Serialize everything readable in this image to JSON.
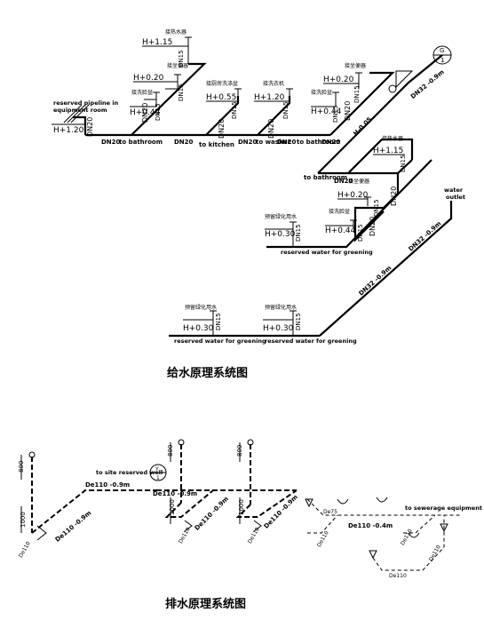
{
  "supply": {
    "title": "给水原理系统图",
    "labels": {
      "reserved_pipeline": "reserved pipeline in",
      "equipment_room": "equipment room",
      "h_plus_1_20_a": "H+1.20",
      "dn20_1": "DN20",
      "to_bathroom_1": "to bathroom",
      "dn20_2": "DN20",
      "to_kitchen": "to kitchen",
      "dn20_3": "DN20",
      "to_washer": "to washer",
      "dn20_4": "DN20",
      "to_bathroom_2": "to bathroom",
      "dn20_5": "DN20",
      "h_plus_1_15_a": "H+1.15",
      "cn_water_heater": "接热水器",
      "dn15_a": "DN15",
      "h_plus_0_20_a": "H+0.20",
      "cn_toilet_a": "接坐便器",
      "dn15_b": "DN15",
      "cn_basin_a": "接洗脸盆",
      "h_plus_0_44_a": "H+0.44",
      "dn15_c": "DN15",
      "dn20_6": "DN20",
      "cn_kitchen_sink": "接厨房洗涤盆",
      "h_plus_0_55": "H+0.55",
      "dn15_d": "DN15",
      "dn20_7": "DN20",
      "cn_washer": "接洗衣机",
      "h_plus_1_20_b": "H+1.20",
      "dn15_e": "DN15",
      "dn20_8": "DN20",
      "h_plus_0_20_b": "H+0.20",
      "cn_toilet_b": "接坐便器",
      "dn15_f": "DN15",
      "cn_basin_b": "接洗脸盆",
      "h_plus_0_44_b": "H+0.44",
      "dn15_g": "DN15",
      "dn20_9": "DN20",
      "h_minus_0_05": "H-0.05",
      "dn32_0_9m_a": "DN32 -0.9m",
      "meter_top": "G",
      "meter_bottom": "1",
      "cn_water_heater_b": "接热水器",
      "h_plus_1_15_b": "H+1.15",
      "dn15_h": "DN15",
      "to_bathroom_3": "to bathroom",
      "dn20_10": "DN20",
      "cn_toilet_c": "接坐便器",
      "h_plus_0_20_c": "H+0.20",
      "dn15_i": "DN15",
      "dn20_11": "DN20",
      "cn_basin_c": "接洗脸盆",
      "h_plus_0_44_c": "H+0.44",
      "dn15_j": "DN15",
      "dn20_12": "DN20",
      "cn_greening_a": "预留绿化用水",
      "h_plus_0_30_a": "H+0.30",
      "dn15_k": "DN15",
      "reserved_greening_a": "reserved water for greening",
      "water": "water",
      "outlet": "outlet",
      "dn32_0_9m_b": "DN32 -0.9m",
      "dn32_0_9m_c": "DN32 -0.9m",
      "cn_greening_b": "预留绿化用水",
      "h_plus_0_30_b": "H+0.30",
      "dn15_l": "DN15",
      "reserved_greening_b": "reserved water for greening",
      "cn_greening_c": "预留绿化用水",
      "h_plus_0_30_c": "H+0.30",
      "dn15_m": "DN15",
      "reserved_greening_c": "reserved water for greening"
    }
  },
  "drainage": {
    "title": "排水原理系统图",
    "labels": {
      "h800_a": "800",
      "h1000_a": "1000",
      "de110_a": "De110",
      "de110_0_9m_a": "De110 -0.9m",
      "de110_0_9m_b": "De110 -0.9m",
      "to_site_well": "to site reserved well",
      "well_top": "Y",
      "well_bottom": "1",
      "h800_b": "800",
      "de110_0_9m_c": "De110 -0.9m",
      "h1000_b": "1000",
      "de110_0_9m_d": "De110 -0.9m",
      "de110_b": "De110",
      "h800_c": "800",
      "h1000_c": "1000",
      "de110_0_9m_e": "De110 -0.9m",
      "de110_c": "De110",
      "to_sewerage": "to sewerage equipment",
      "de75": "De75",
      "de110_0_4m": "De110 -0.4m",
      "de110_d": "De110",
      "de110_e": "De110",
      "de110_f": "De110",
      "de110_g": "De110"
    }
  }
}
